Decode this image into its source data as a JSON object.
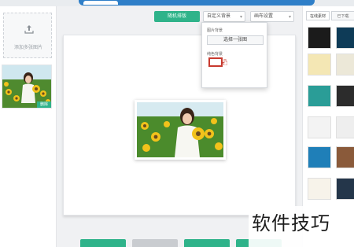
{
  "toolbar": {
    "random_layout_label": "随机排版",
    "custom_bg_label": "自定义背景",
    "canvas_settings_label": "画布设置"
  },
  "left_panel": {
    "add_images_label": "添加多张图片",
    "delete_badge": "删除"
  },
  "dropdown": {
    "image_bg_label": "图片背景",
    "choose_image_label": "选择一张图",
    "solid_bg_label": "纯色背景",
    "selected_color": "#ffffff"
  },
  "right_panel": {
    "tabs": [
      {
        "label": "在线素材"
      },
      {
        "label": "已下载"
      }
    ]
  },
  "watermark": "软件技巧",
  "colors": {
    "accent_green": "#2fb38a",
    "header_blue": "#2f7fc8",
    "highlight_red": "#c83a2f"
  }
}
